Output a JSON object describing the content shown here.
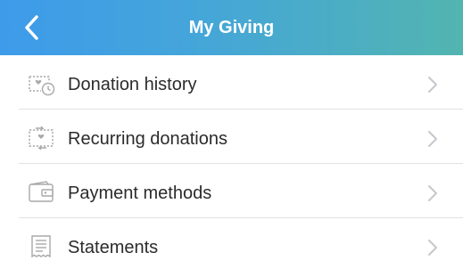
{
  "header": {
    "title": "My Giving",
    "back_icon": "chevron-left-icon"
  },
  "menu": {
    "items": [
      {
        "label": "Donation history",
        "icon": "donation-history-icon"
      },
      {
        "label": "Recurring donations",
        "icon": "recurring-donations-icon"
      },
      {
        "label": "Payment methods",
        "icon": "wallet-icon"
      },
      {
        "label": "Statements",
        "icon": "statements-icon"
      }
    ],
    "chevron_icon": "chevron-right-icon"
  },
  "colors": {
    "header_gradient_start": "#3d9bea",
    "header_gradient_end": "#52b5b0",
    "icon_gray": "#a9a9a9",
    "chevron_gray": "#c7c7cc",
    "text": "#2b2b2b"
  }
}
